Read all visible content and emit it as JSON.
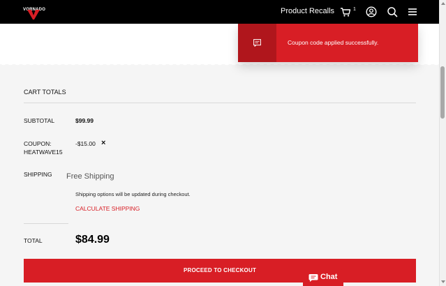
{
  "header": {
    "logo_text": "VORNADO",
    "nav_link": "Product Recalls",
    "cart_count": "1",
    "icons": [
      "cart-icon",
      "account-icon",
      "search-icon",
      "menu-icon"
    ]
  },
  "toast": {
    "message": "Coupon code applied successfully.",
    "icon": "message-icon"
  },
  "cart_totals": {
    "title": "CART TOTALS",
    "subtotal_label": "SUBTOTAL",
    "subtotal_value": "$99.99",
    "coupon_label_line1": "COUPON:",
    "coupon_label_line2": "HEATWAVE15",
    "coupon_value": "-$15.00",
    "coupon_remove": "×",
    "shipping_label": "SHIPPING",
    "shipping_method": "Free Shipping",
    "shipping_note": "Shipping options will be updated during checkout.",
    "calculate_shipping": "CALCULATE SHIPPING",
    "total_label": "TOTAL",
    "total_value": "$84.99"
  },
  "checkout_button": "PROCEED TO CHECKOUT",
  "chat": {
    "label": "Chat",
    "icon": "chat-bubble-icon"
  },
  "colors": {
    "brand_red": "#d81e25",
    "dark_red": "#b0161c",
    "header_bg": "#000000"
  }
}
